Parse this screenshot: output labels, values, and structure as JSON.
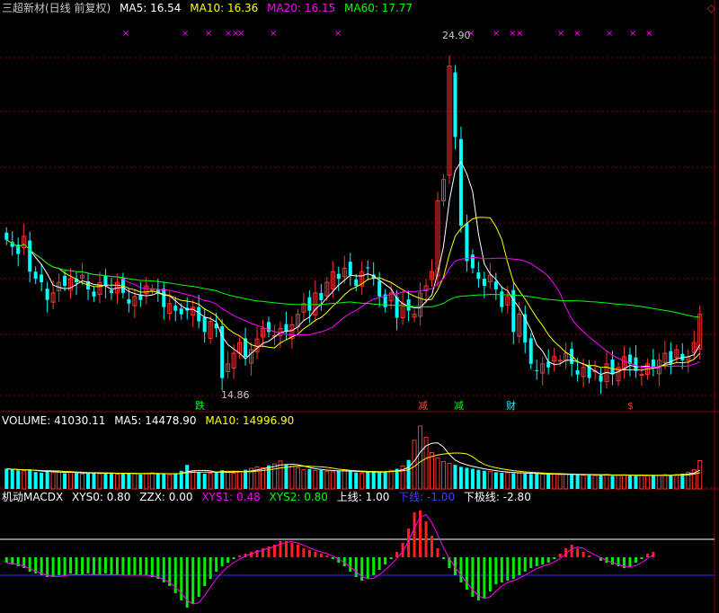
{
  "header": {
    "title": "三超新材(日线 前复权)",
    "ma5": "MA5: 16.54",
    "ma10": "MA10: 16.36",
    "ma20": "MA20: 16.15",
    "ma60": "MA60: 17.77"
  },
  "price_labels": {
    "high": "24.90",
    "low": "14.86"
  },
  "event_markers": [
    "跌",
    "减",
    "减",
    "财",
    "$"
  ],
  "volume_header": {
    "volume": "VOLUME: 41030.11",
    "ma5": "MA5: 14478.90",
    "ma10": "MA10: 14996.90"
  },
  "macd_header": {
    "name": "机动MACDX",
    "xys0": "XYS0: 0.80",
    "zzx": "ZZX: 0.00",
    "xys1": "XYS1: 0.48",
    "xys2": "XYS2: 0.80",
    "upper": "上线: 1.00",
    "lower": "下线: -1.00",
    "bottom": "下极线: -2.80"
  },
  "colors": {
    "up": "#ff3232",
    "down": "#00ffff",
    "ma5": "#ffffff",
    "ma10": "#ffff00",
    "ma20": "#ff00ff",
    "ma60": "#00ff00"
  },
  "chart_data": {
    "type": "candlestick",
    "price_range": [
      14.86,
      24.9
    ],
    "close": [
      19.1,
      18.9,
      18.7,
      19.2,
      18.2,
      18.0,
      17.9,
      17.4,
      17.6,
      17.9,
      17.8,
      18.0,
      17.9,
      18.1,
      17.7,
      17.5,
      17.9,
      17.8,
      17.6,
      17.9,
      17.6,
      17.3,
      17.5,
      17.4,
      17.8,
      17.7,
      17.6,
      17.2,
      17.3,
      17.1,
      17.0,
      17.1,
      17.2,
      16.8,
      16.5,
      16.8,
      16.6,
      15.2,
      15.6,
      15.9,
      16.2,
      15.8,
      16.0,
      16.3,
      16.6,
      16.5,
      16.4,
      16.6,
      16.5,
      16.7,
      17.0,
      17.3,
      17.1,
      17.6,
      17.4,
      17.9,
      18.2,
      18.0,
      18.3,
      18.1,
      17.8,
      18.2,
      18.3,
      18.0,
      17.5,
      17.2,
      17.6,
      16.9,
      17.3,
      17.1,
      17.0,
      17.6,
      17.8,
      18.2,
      20.2,
      20.8,
      24.0,
      22.0,
      19.5,
      18.5,
      18.3,
      18.0,
      17.8,
      18.1,
      17.7,
      17.2,
      17.5,
      16.5,
      17.0,
      16.2,
      15.6,
      15.4,
      15.6,
      15.5,
      15.8,
      15.7,
      15.9,
      15.6,
      15.3,
      15.5,
      15.2,
      15.4,
      15.1,
      15.6,
      15.3,
      15.5,
      15.8,
      15.6,
      15.4,
      15.3,
      15.6,
      15.5,
      15.7,
      15.9,
      15.6,
      16.0,
      15.7,
      15.8,
      16.2,
      17.0
    ],
    "volume": [
      8200,
      7900,
      7600,
      7400,
      7800,
      6900,
      6600,
      7200,
      6700,
      6900,
      6400,
      6800,
      6500,
      6100,
      6700,
      6500,
      6200,
      6600,
      6300,
      6000,
      6500,
      6400,
      6200,
      5900,
      6300,
      6600,
      6100,
      6200,
      5800,
      6000,
      7400,
      9800,
      7500,
      6900,
      6200,
      6400,
      7000,
      7600,
      6800,
      6400,
      7100,
      7800,
      8400,
      9000,
      8600,
      9600,
      10200,
      11400,
      9800,
      9200,
      8600,
      7900,
      8100,
      7500,
      7700,
      7200,
      7000,
      7400,
      7600,
      7100,
      6700,
      6500,
      6900,
      7300,
      6800,
      7100,
      7600,
      8200,
      9400,
      11800,
      19800,
      25600,
      21000,
      14800,
      12600,
      11200,
      10400,
      9800,
      9000,
      8600,
      8200,
      7800,
      7400,
      7100,
      6800,
      6600,
      6700,
      6400,
      6500,
      6200,
      6100,
      6300,
      6000,
      5900,
      6100,
      5800,
      6000,
      5700,
      5900,
      5600,
      5800,
      5500,
      5700,
      5900,
      5400,
      5600,
      5800,
      5500,
      5300,
      5600,
      5400,
      5700,
      5500,
      5800,
      5600,
      5900,
      6200,
      6800,
      7800,
      11500
    ],
    "macd_hist": [
      -0.3,
      -0.4,
      -0.5,
      -0.6,
      -0.8,
      -0.9,
      -1.0,
      -1.1,
      -1.1,
      -1.0,
      -1.0,
      -0.9,
      -1.0,
      -1.0,
      -0.9,
      -1.0,
      -1.0,
      -0.9,
      -1.0,
      -1.0,
      -1.0,
      -1.0,
      -1.0,
      -1.0,
      -1.0,
      -1.1,
      -1.2,
      -1.4,
      -1.6,
      -2.0,
      -2.4,
      -2.8,
      -2.6,
      -2.2,
      -1.6,
      -1.2,
      -0.8,
      -0.5,
      -0.3,
      -0.1,
      0.1,
      0.2,
      0.3,
      0.4,
      0.5,
      0.6,
      0.7,
      0.9,
      0.9,
      0.8,
      0.7,
      0.5,
      0.4,
      0.3,
      0.2,
      0.1,
      -0.1,
      -0.3,
      -0.5,
      -0.8,
      -1.1,
      -1.3,
      -1.2,
      -1.0,
      -0.7,
      -0.4,
      -0.1,
      0.3,
      0.8,
      1.6,
      2.5,
      2.6,
      2.0,
      1.2,
      0.5,
      -0.1,
      -0.6,
      -1.0,
      -1.4,
      -1.8,
      -2.2,
      -2.4,
      -2.3,
      -1.9,
      -1.5,
      -1.4,
      -1.3,
      -1.2,
      -1.0,
      -0.8,
      -0.6,
      -0.5,
      -0.4,
      -0.3,
      -0.1,
      0.2,
      0.5,
      0.7,
      0.5,
      0.3,
      0.1,
      0.0,
      -0.2,
      -0.3,
      -0.4,
      -0.5,
      -0.6,
      -0.5,
      -0.3,
      -0.1,
      0.2,
      0.3
    ]
  }
}
